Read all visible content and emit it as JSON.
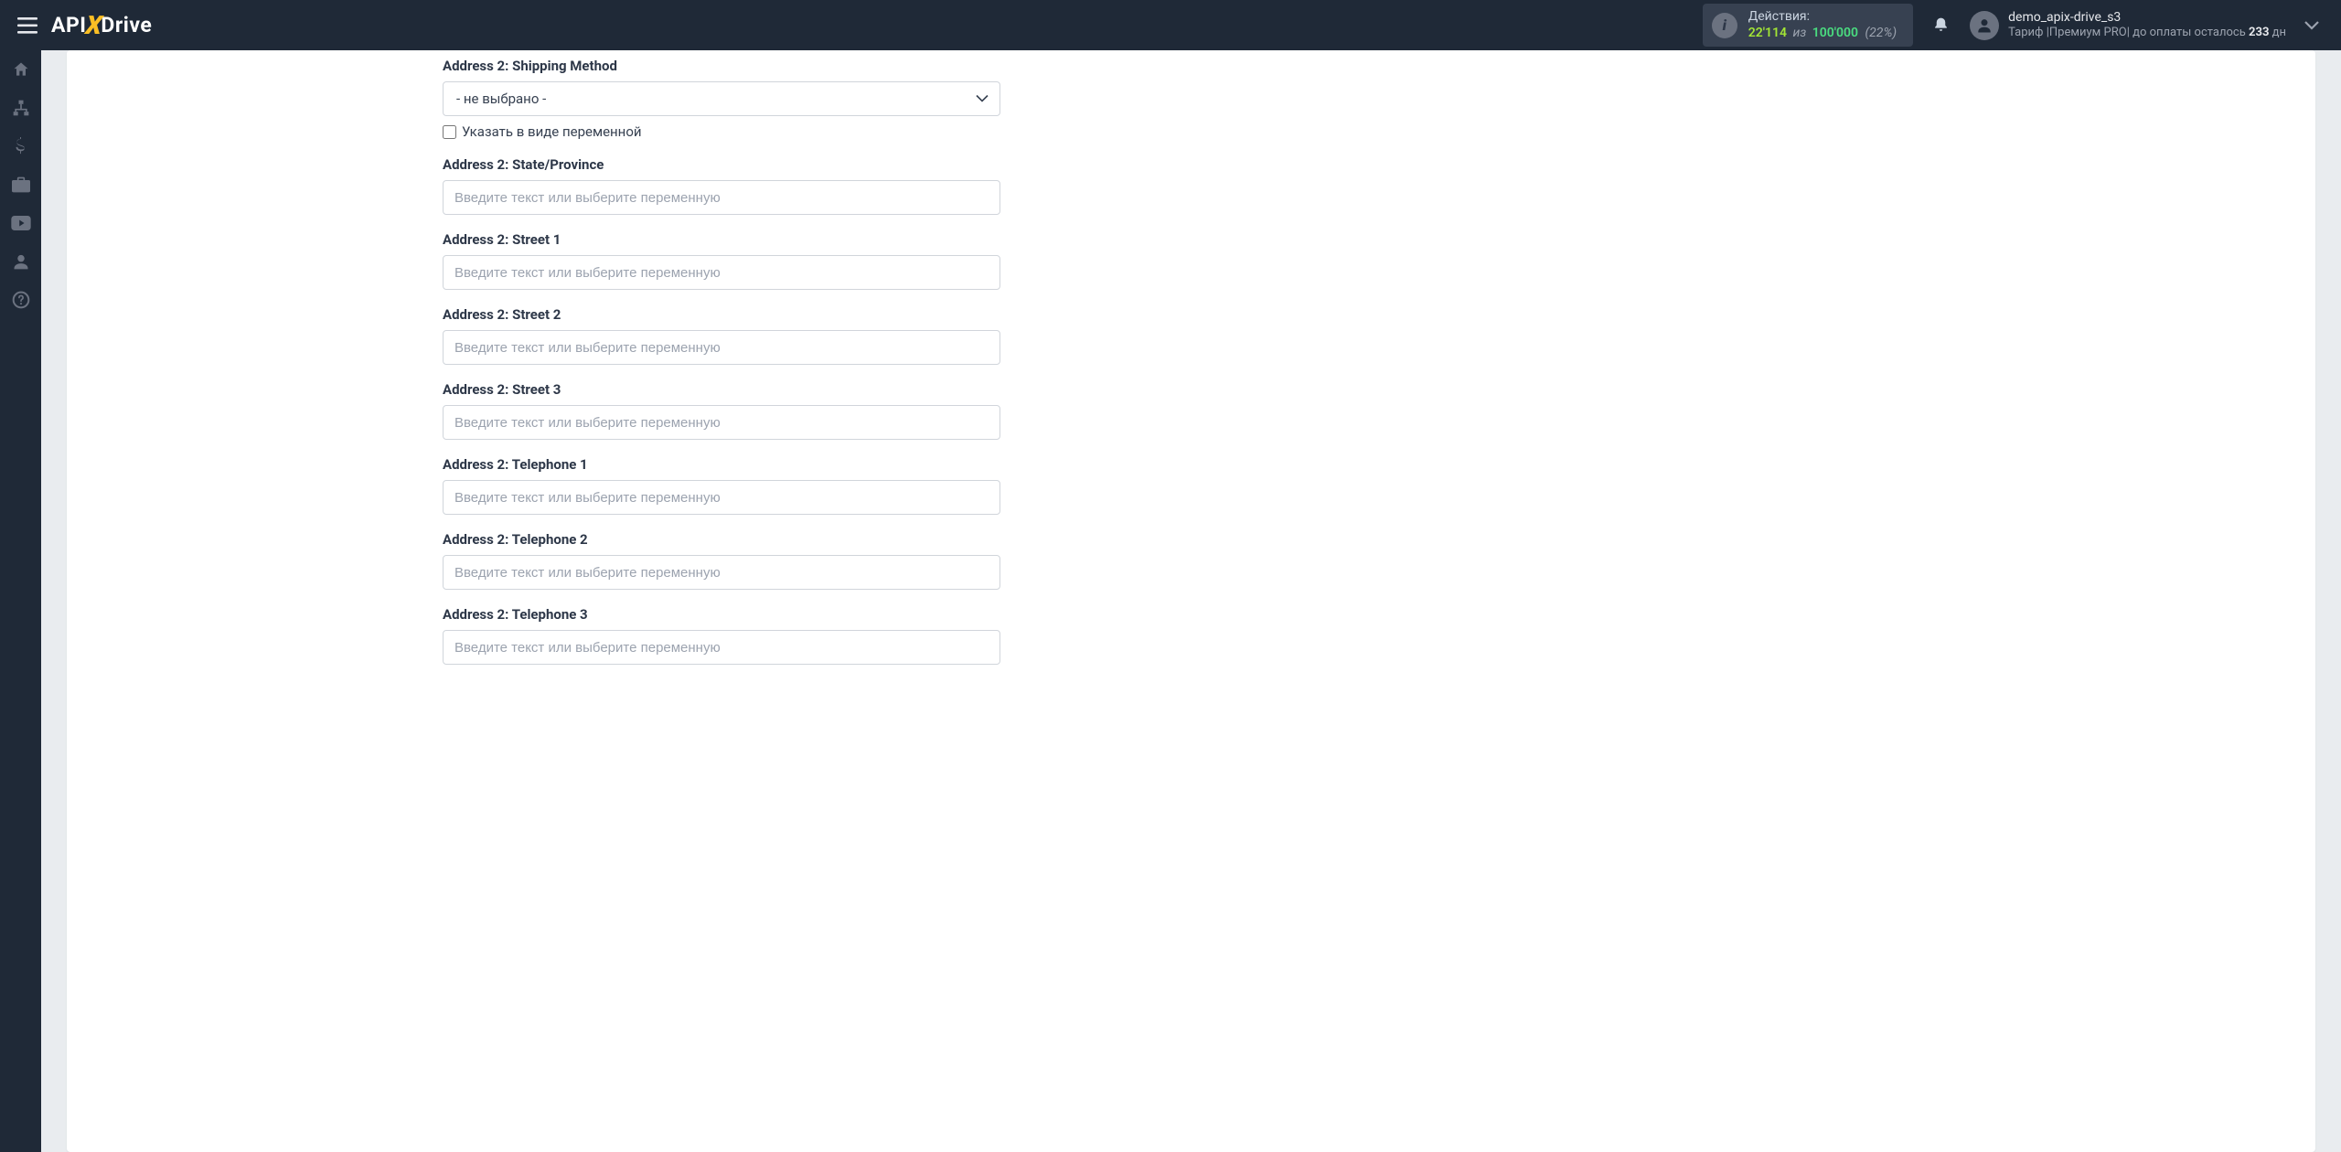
{
  "logo": {
    "part1": "API",
    "x": "X",
    "part2": "Drive"
  },
  "actions": {
    "label": "Действия:",
    "used": "22'114",
    "of": "из",
    "limit": "100'000",
    "pct": "(22%)"
  },
  "user": {
    "name": "demo_apix-drive_s3",
    "tariff_label": "Тариф",
    "tariff": "Премиум PRO",
    "payment_prefix": "до оплаты осталось",
    "days": "233",
    "payment_suffix": "дн"
  },
  "form": {
    "shipping": {
      "label": "Address 2: Shipping Method",
      "value": "- не выбрано -",
      "checkbox": "Указать в виде переменной"
    },
    "placeholder": "Введите текст или выберите переменную",
    "fields": [
      {
        "key": "state",
        "label": "Address 2: State/Province"
      },
      {
        "key": "street1",
        "label": "Address 2: Street 1"
      },
      {
        "key": "street2",
        "label": "Address 2: Street 2"
      },
      {
        "key": "street3",
        "label": "Address 2: Street 3"
      },
      {
        "key": "tel1",
        "label": "Address 2: Telephone 1"
      },
      {
        "key": "tel2",
        "label": "Address 2: Telephone 2"
      },
      {
        "key": "tel3",
        "label": "Address 2: Telephone 3"
      }
    ]
  }
}
